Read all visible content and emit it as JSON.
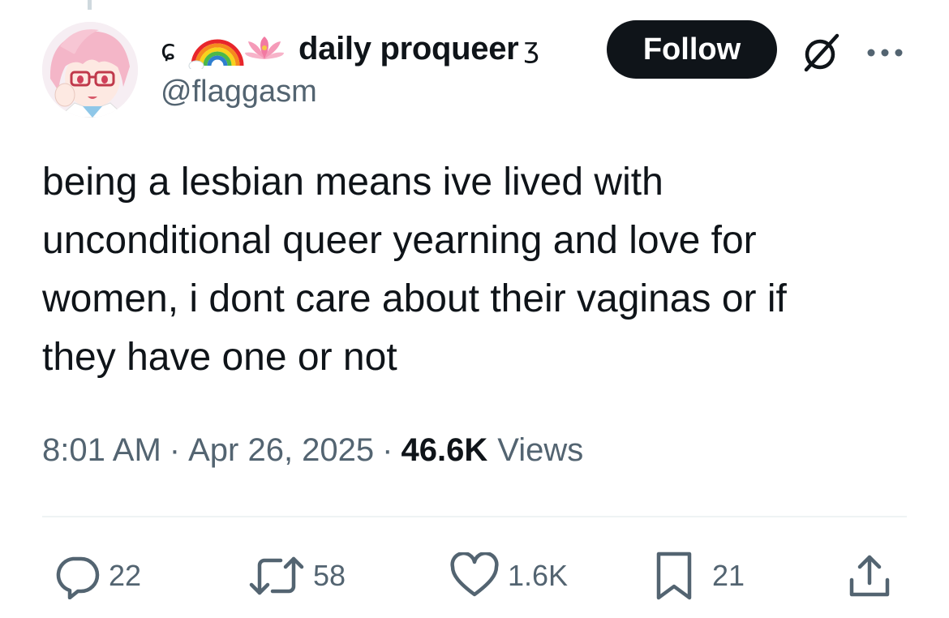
{
  "tweet": {
    "author": {
      "display_name": "daily proqueer",
      "name_emoji_prefix": "( rainbow lotus",
      "name_suffix_glyph": "ʒ",
      "handle": "@flaggasm",
      "avatar": "anime-girl-avatar"
    },
    "follow_label": "Follow",
    "text": "being a lesbian means ive lived with\nunconditional queer yearning and love for\nwomen, i dont care about their vaginas or if\nthey have one or not",
    "time": "8:01 AM",
    "date": "Apr 26, 2025",
    "separator": "·",
    "views_count": "46.6K",
    "views_label": "Views",
    "actions": {
      "replies": "22",
      "reposts": "58",
      "likes": "1.6K",
      "bookmarks": "21"
    }
  },
  "icons": {
    "grok": "grok-icon",
    "more": "more-icon",
    "reply": "reply-icon",
    "repost": "repost-icon",
    "like": "heart-icon",
    "bookmark": "bookmark-icon",
    "share": "share-icon"
  },
  "colors": {
    "text_primary": "#0f1419",
    "text_secondary": "#536471",
    "follow_bg": "#0f1419",
    "follow_text": "#ffffff",
    "divider": "#eff3f4"
  }
}
